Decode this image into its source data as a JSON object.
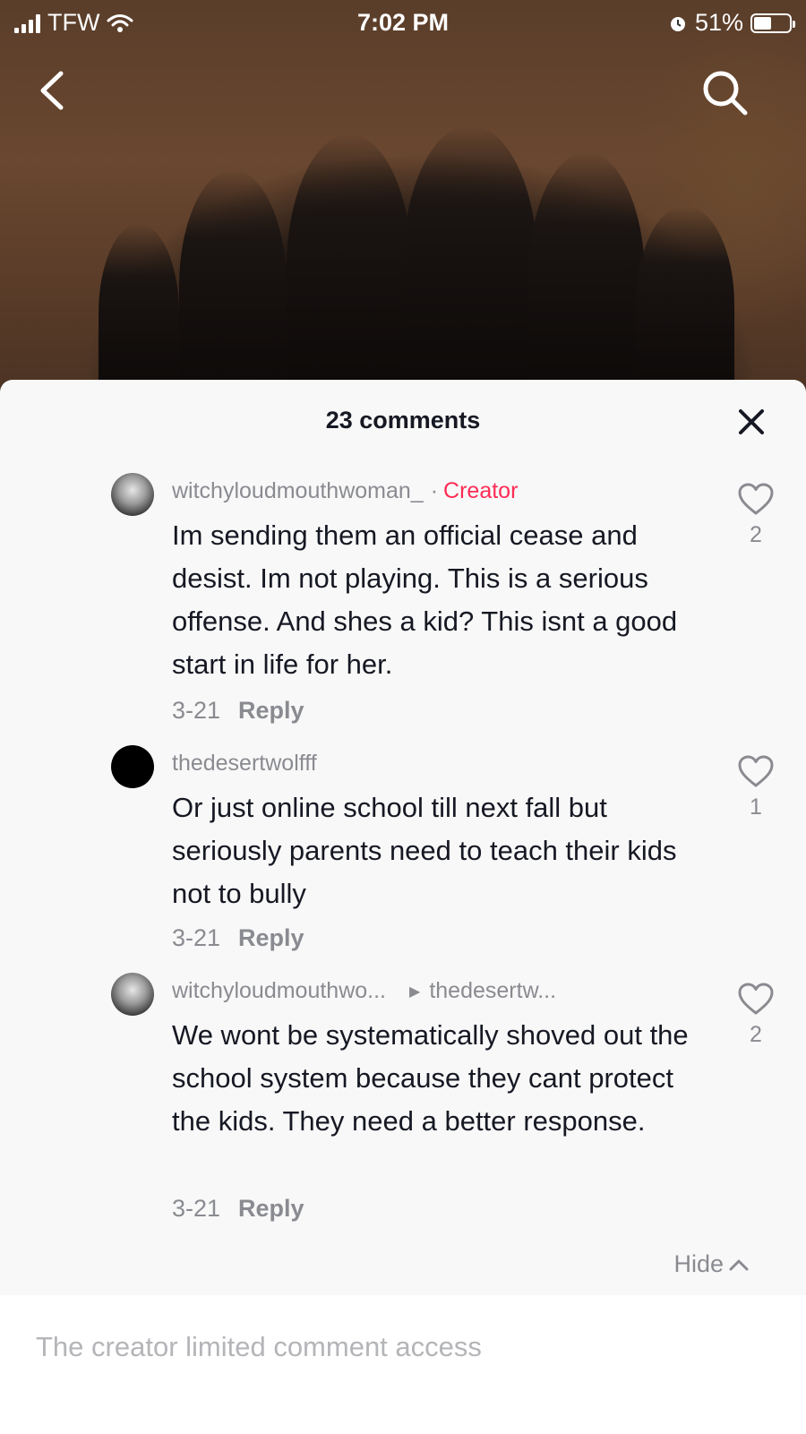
{
  "status_bar": {
    "carrier": "TFW",
    "time": "7:02 PM",
    "battery": "51%",
    "battery_level": 0.51
  },
  "icons": {
    "back": "chevron-left-icon",
    "search": "search-icon",
    "close": "close-icon",
    "like": "heart-outline-icon",
    "wifi": "wifi-icon",
    "alarm": "alarm-icon",
    "reply_to": "triangle-right-icon",
    "hide": "chevron-up-icon"
  },
  "sheet": {
    "title": "23 comments",
    "hide_label": "Hide"
  },
  "comments": [
    {
      "username": "witchyloudmouthwoman_",
      "creator_label": "Creator",
      "text": "Im sending them an official cease and desist. Im not playing. This is a serious offense. And shes a kid? This isnt a good start in life for her.",
      "date": "3-21",
      "reply_label": "Reply",
      "likes": "2"
    },
    {
      "username": "thedesertwolfff",
      "text": "Or just online school till next fall but seriously parents need to teach their kids not to bully",
      "date": "3-21",
      "reply_label": "Reply",
      "likes": "1"
    },
    {
      "username": "witchyloudmouthwo...",
      "reply_to": "thedesertw...",
      "text": "We wont be systematically shoved out the school system because they cant protect the kids. They need a better response.",
      "date": "3-21",
      "reply_label": "Reply",
      "likes": "2"
    }
  ],
  "footer": {
    "notice": "The creator limited comment access"
  },
  "colors": {
    "creator_accent": "#fe2c55",
    "muted_text": "#8a8b91",
    "primary_text": "#161823",
    "sheet_bg": "#f8f8f8"
  }
}
